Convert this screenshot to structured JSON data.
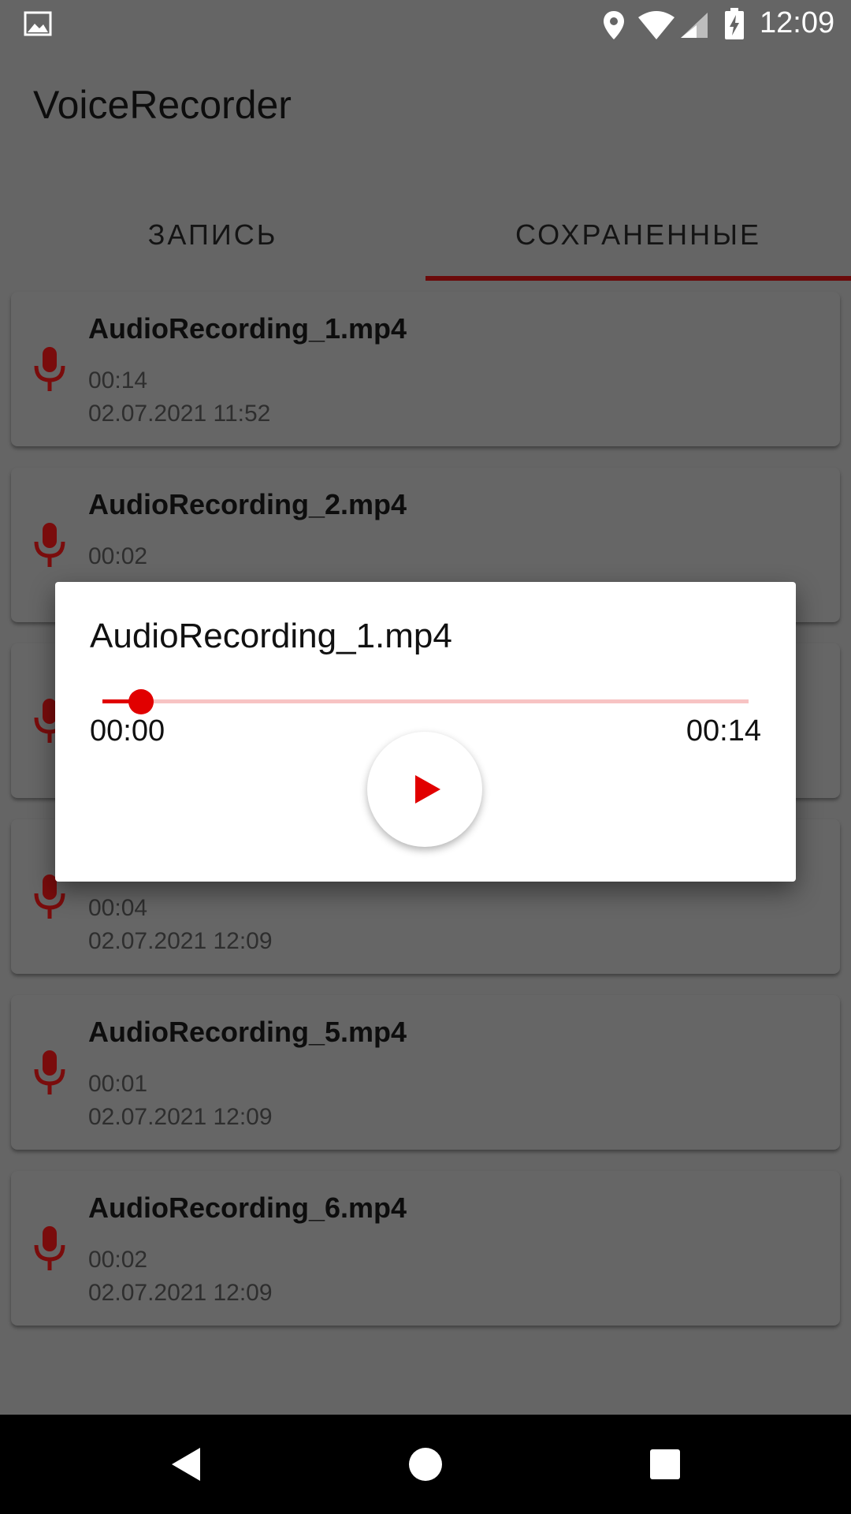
{
  "status_bar": {
    "time": "12:09",
    "icons": [
      "gallery-icon",
      "location-icon",
      "wifi-icon",
      "cell-signal-icon",
      "battery-charging-icon"
    ]
  },
  "app": {
    "title": "VoiceRecorder"
  },
  "tabs": [
    {
      "label": "ЗАПИСЬ",
      "selected": false
    },
    {
      "label": "СОХРАНЕННЫЕ",
      "selected": true
    }
  ],
  "recordings": [
    {
      "name": "AudioRecording_1.mp4",
      "duration": "00:14",
      "date": "02.07.2021 11:52"
    },
    {
      "name": "AudioRecording_2.mp4",
      "duration": "00:02",
      "date": ""
    },
    {
      "name": "",
      "duration": "",
      "date": ""
    },
    {
      "name": "",
      "duration": "00:04",
      "date": "02.07.2021 12:09"
    },
    {
      "name": "AudioRecording_5.mp4",
      "duration": "00:01",
      "date": "02.07.2021 12:09"
    },
    {
      "name": "AudioRecording_6.mp4",
      "duration": "00:02",
      "date": "02.07.2021 12:09"
    }
  ],
  "player_dialog": {
    "title": "AudioRecording_1.mp4",
    "current_time": "00:00",
    "total_time": "00:14",
    "progress_fraction": 0.06,
    "play_icon": "play-icon"
  },
  "nav_bar": {
    "icons": [
      "back-icon",
      "home-icon",
      "recents-icon"
    ]
  },
  "colors": {
    "accent": "#e10000",
    "mic": "#7a0c0c",
    "indicator": "#6b0a0a",
    "scrim_background": "#656565"
  }
}
